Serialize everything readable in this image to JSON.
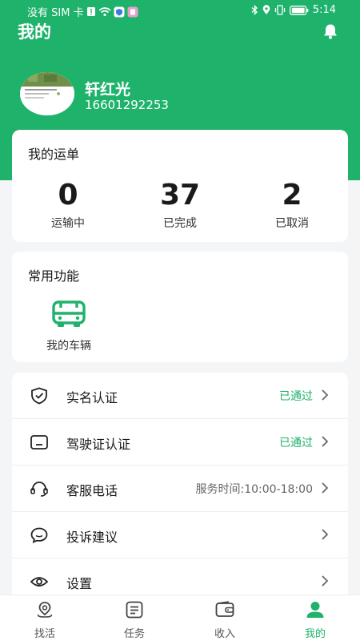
{
  "status_bar": {
    "carrier": "没有 SIM 卡",
    "time": "5:14"
  },
  "header": {
    "title": "我的"
  },
  "profile": {
    "name": "轩红光",
    "phone": "16601292253"
  },
  "waybill": {
    "title": "我的运单",
    "stats": [
      {
        "value": "0",
        "label": "运输中"
      },
      {
        "value": "37",
        "label": "已完成"
      },
      {
        "value": "2",
        "label": "已取消"
      }
    ]
  },
  "functions": {
    "title": "常用功能",
    "items": [
      {
        "label": "我的车辆",
        "icon": "vehicle-icon"
      }
    ]
  },
  "menu": {
    "items": [
      {
        "label": "实名认证",
        "value": "已通过",
        "icon": "shield-check-icon"
      },
      {
        "label": "驾驶证认证",
        "value": "已通过",
        "icon": "license-card-icon"
      },
      {
        "label": "客服电话",
        "value": "服务时间:10:00-18:00",
        "icon": "headset-icon"
      },
      {
        "label": "投诉建议",
        "value": "",
        "icon": "chat-bubble-icon"
      },
      {
        "label": "设置",
        "value": "",
        "icon": "eye-settings-icon"
      }
    ]
  },
  "tabs": {
    "items": [
      {
        "label": "找活",
        "icon": "location-pin-icon"
      },
      {
        "label": "任务",
        "icon": "task-list-icon"
      },
      {
        "label": "收入",
        "icon": "wallet-icon"
      },
      {
        "label": "我的",
        "icon": "person-icon",
        "active": true
      }
    ]
  },
  "colors": {
    "brand": "#1fb26b",
    "background": "#f4f5f7"
  }
}
